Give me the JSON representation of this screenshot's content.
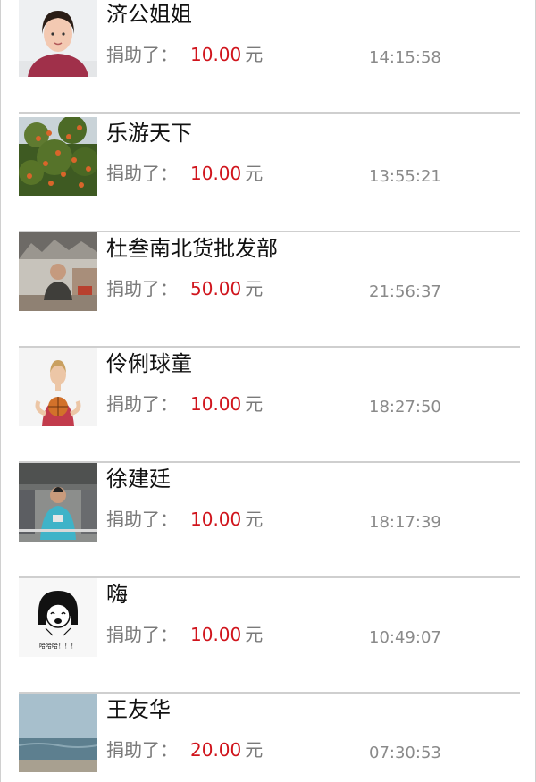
{
  "donations": [
    {
      "name": "济公姐姐",
      "label": "捐助了：",
      "amount": "10.00",
      "unit": "元",
      "time": "14:15:58"
    },
    {
      "name": "乐游天下",
      "label": "捐助了：",
      "amount": "10.00",
      "unit": "元",
      "time": "13:55:21"
    },
    {
      "name": "杜叁南北货批发部",
      "label": "捐助了：",
      "amount": "50.00",
      "unit": "元",
      "time": "21:56:37"
    },
    {
      "name": "伶俐球童",
      "label": "捐助了：",
      "amount": "10.00",
      "unit": "元",
      "time": "18:27:50"
    },
    {
      "name": "徐建廷",
      "label": "捐助了：",
      "amount": "10.00",
      "unit": "元",
      "time": "18:17:39"
    },
    {
      "name": "嗨",
      "label": "捐助了：",
      "amount": "10.00",
      "unit": "元",
      "time": "10:49:07",
      "avatar_text": "哈哈哈！！！"
    },
    {
      "name": "王友华",
      "label": "捐助了：",
      "amount": "20.00",
      "unit": "元",
      "time": "07:30:53"
    }
  ],
  "colors": {
    "amount": "#d0141c",
    "label": "#7a7a7a",
    "name": "#111111",
    "divider": "#cfcfcf"
  }
}
